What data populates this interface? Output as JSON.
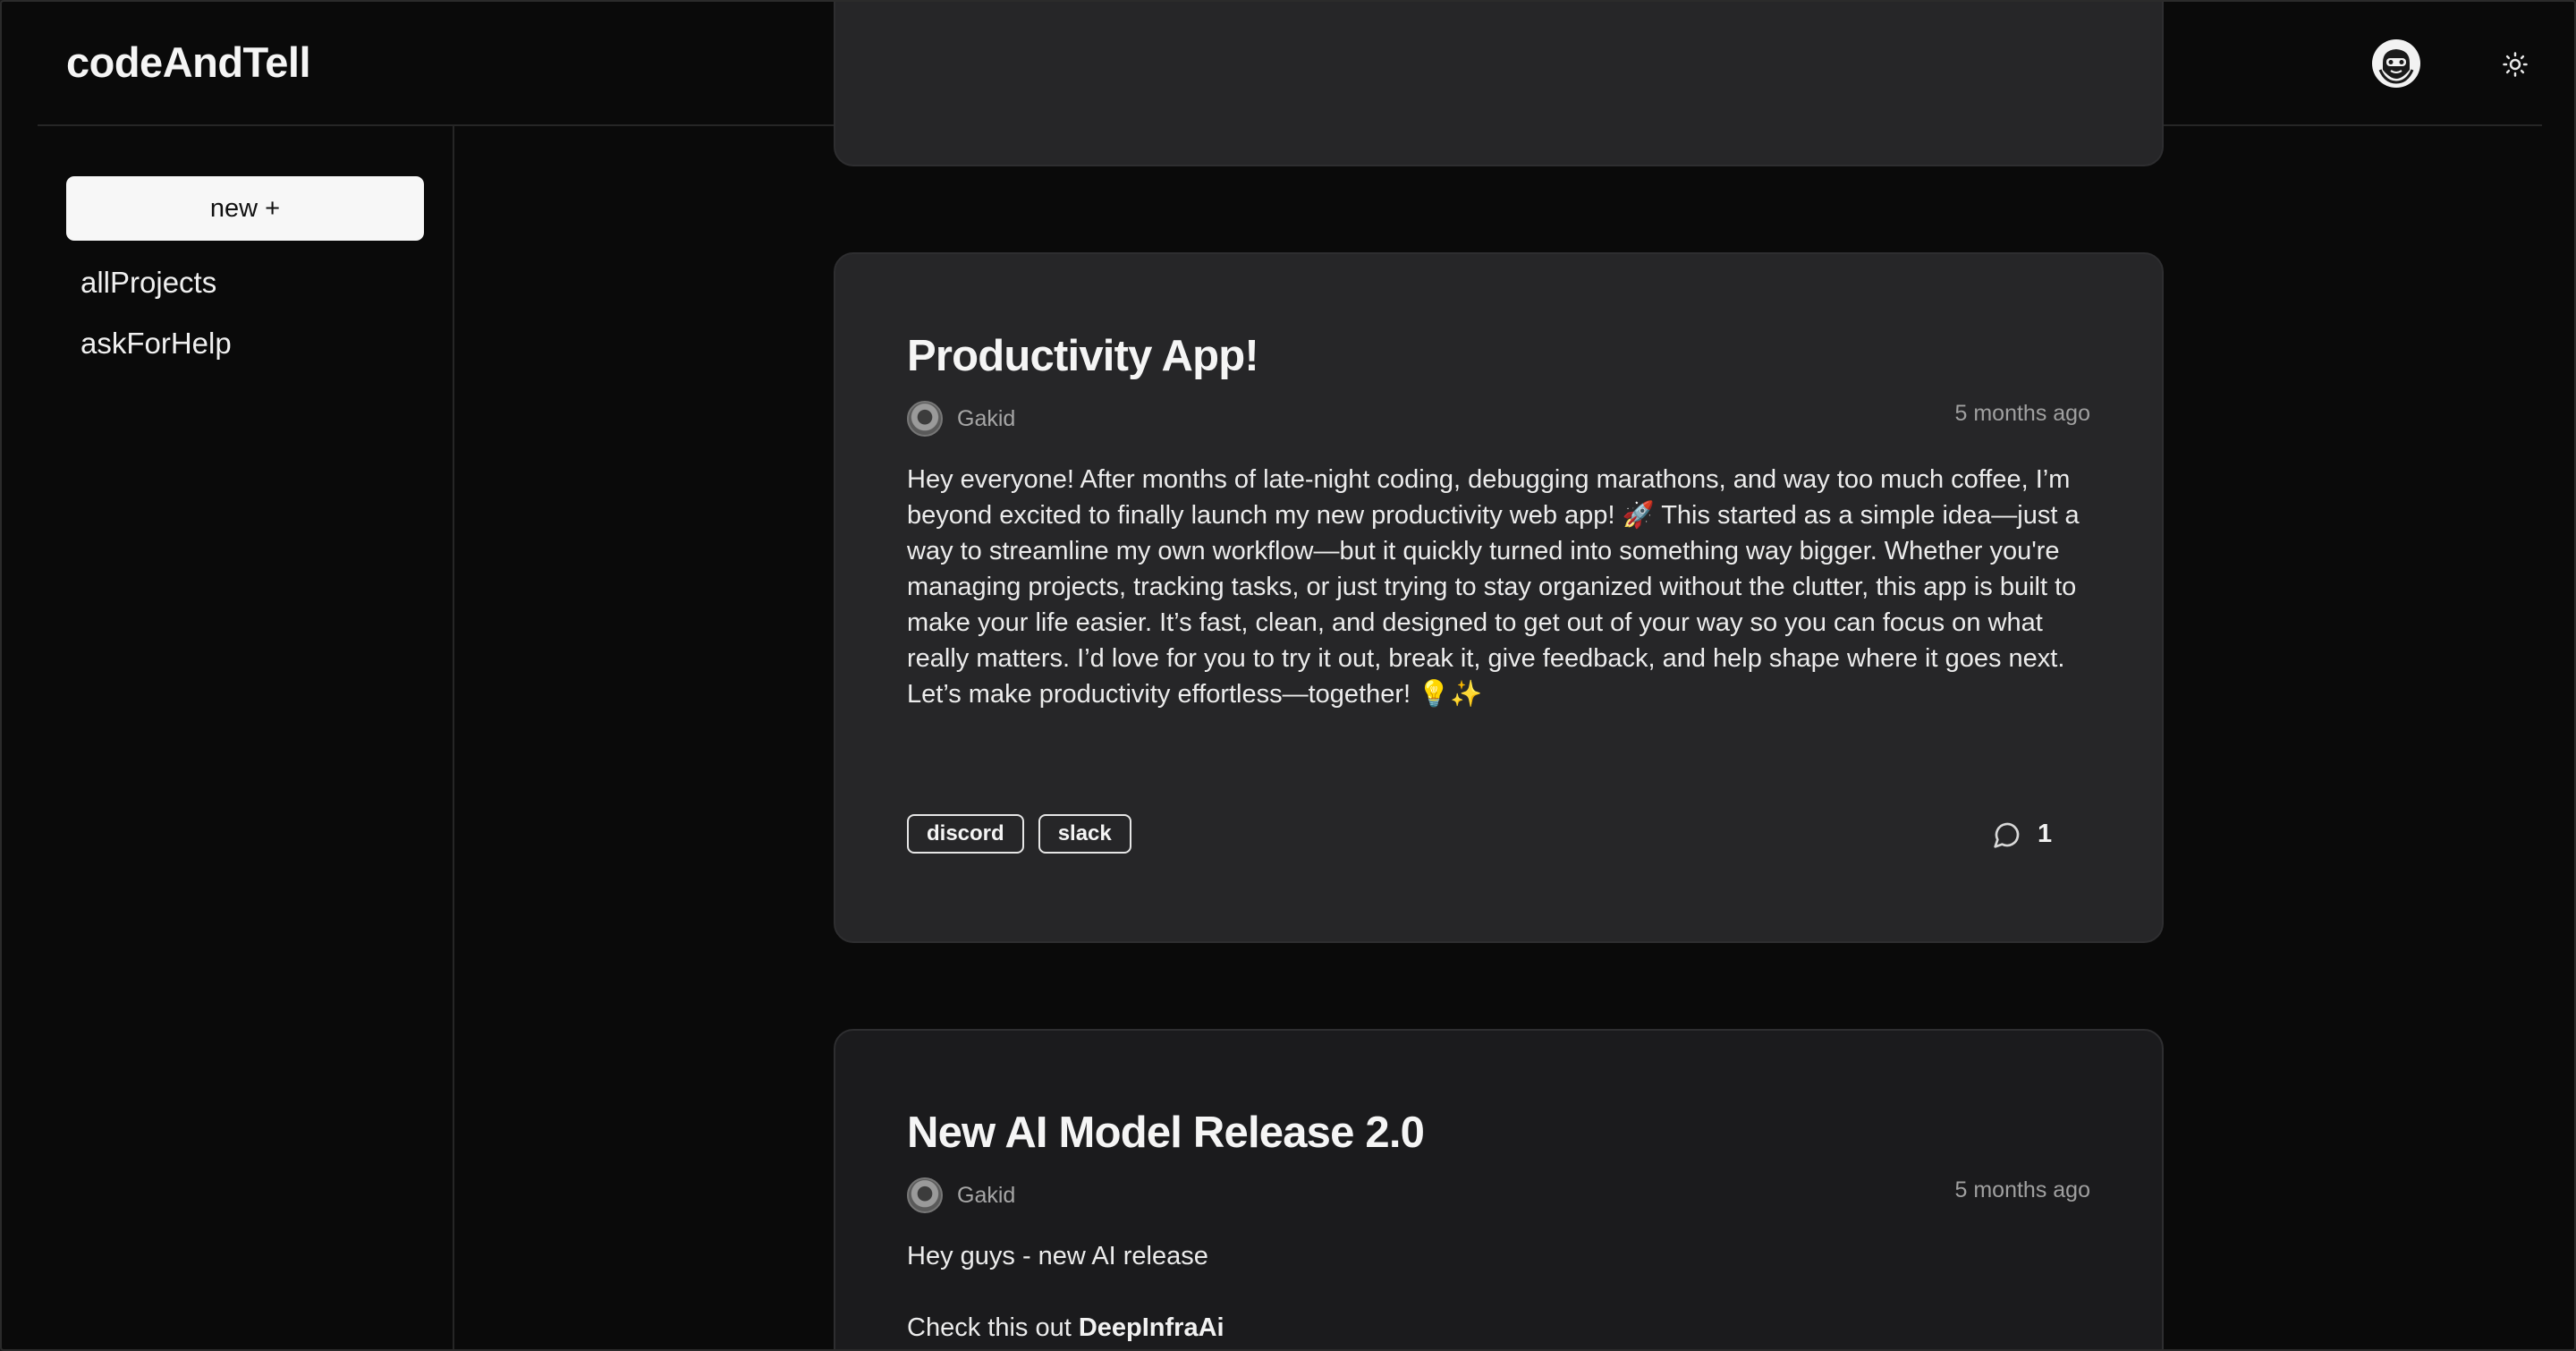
{
  "header": {
    "brand": "codeAndTell",
    "user_avatar_icon": "user-avatar-icon",
    "theme_toggle_icon": "sun-icon"
  },
  "sidebar": {
    "new_button_label": "new +",
    "items": [
      {
        "label": "allProjects"
      },
      {
        "label": "askForHelp"
      }
    ]
  },
  "posts": [
    {
      "title": "Productivity App!",
      "author": "Gakid",
      "timestamp": "5 months ago",
      "body": "Hey everyone! After months of late-night coding, debugging marathons, and way too much coffee, I’m beyond excited to finally launch my new productivity web app! 🚀 This started as a simple idea—just a way to streamline my own workflow—but it quickly turned into something way bigger. Whether you're managing projects, tracking tasks, or just trying to stay organized without the clutter, this app is built to make your life easier. It’s fast, clean, and designed to get out of your way so you can focus on what really matters. I’d love for you to try it out, break it, give feedback, and help shape where it goes next. Let’s make productivity effortless—together! 💡✨",
      "tags": [
        "discord",
        "slack"
      ],
      "comment_count": "1"
    },
    {
      "title": "New AI Model Release 2.0",
      "author": "Gakid",
      "timestamp": "5 months ago",
      "body_line1": "Hey guys - new AI release",
      "body_line2_prefix": "Check this out ",
      "body_link": "DeepInfraAi"
    }
  ],
  "colors": {
    "background": "#0a0a0a",
    "card": "#262628",
    "card_dim": "#1b1b1d",
    "text": "#ededed",
    "muted": "#a6a6a6",
    "new_button_bg": "#f7f7f7"
  }
}
